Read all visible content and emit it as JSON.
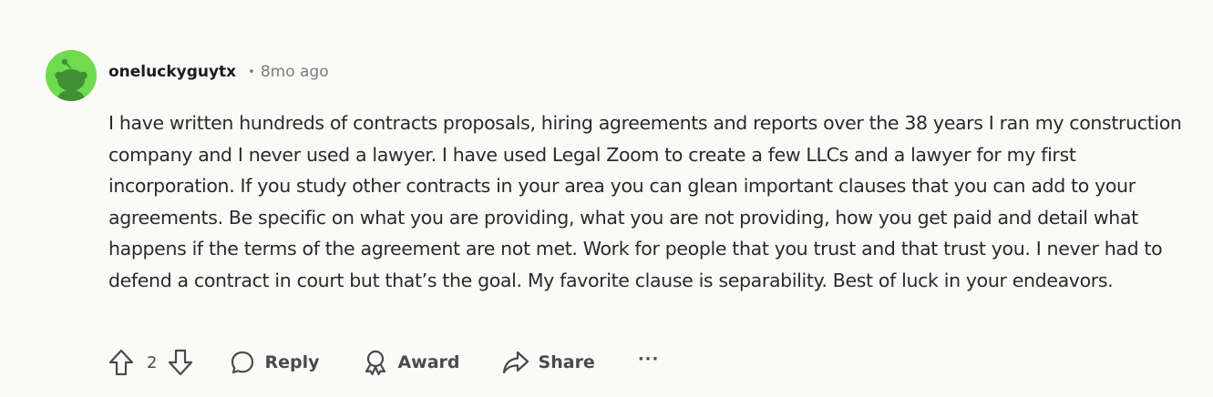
{
  "comment": {
    "author": "oneluckyguytx",
    "separator": "•",
    "timestamp": "8mo ago",
    "avatar_color": "#6fdb4e",
    "avatar_icon": "snoo-avatar-icon",
    "body": "I have written hundreds of contracts proposals, hiring agreements and reports over the 38 years I ran my construction company and I never used a lawyer. I have used Legal Zoom to create a few LLCs and a lawyer for my first incorporation. If you study other contracts in your area you can glean important clauses that you can add to your agreements. Be specific on what you are providing, what you are not providing, how you get paid and detail what happens if the terms of the agreement are not met. Work for people that you trust and that trust you. I never had to defend a contract in court but that’s the goal. My favorite clause is separability. Best of luck in your endeavors."
  },
  "actions": {
    "upvote_icon": "upvote-arrow-icon",
    "vote_count": "2",
    "downvote_icon": "downvote-arrow-icon",
    "reply_label": "Reply",
    "reply_icon": "speech-bubble-icon",
    "award_label": "Award",
    "award_icon": "award-ribbon-icon",
    "share_label": "Share",
    "share_icon": "share-arrow-icon",
    "more_label": "···"
  }
}
